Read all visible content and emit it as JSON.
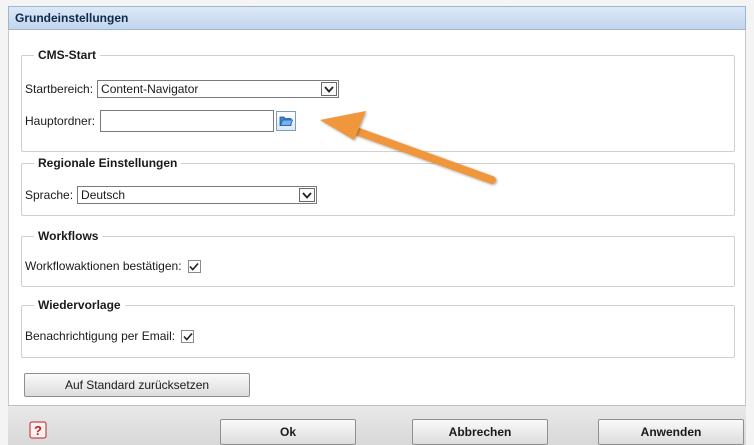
{
  "window": {
    "title": "Grundeinstellungen"
  },
  "cms_start": {
    "legend": "CMS-Start",
    "startbereich_label": "Startbereich:",
    "startbereich_value": "Content-Navigator",
    "hauptordner_label": "Hauptordner:",
    "hauptordner_value": ""
  },
  "regional": {
    "legend": "Regionale Einstellungen",
    "sprache_label": "Sprache:",
    "sprache_value": "Deutsch"
  },
  "workflows": {
    "legend": "Workflows",
    "confirm_label": "Workflowaktionen bestätigen:",
    "confirm_checked": true
  },
  "wiedervorlage": {
    "legend": "Wiedervorlage",
    "email_label": "Benachrichtigung per Email:",
    "email_checked": true
  },
  "reset_button": "Auf Standard zurücksetzen",
  "footer": {
    "ok": "Ok",
    "cancel": "Abbrechen",
    "apply": "Anwenden"
  },
  "icons": {
    "help": "help-question-icon",
    "folder": "folder-open-icon",
    "dropdown": "chevron-down-icon",
    "check": "checkmark-icon"
  },
  "colors": {
    "annotation_arrow": "#f0963c",
    "title_bar": "#c3d6ee"
  }
}
